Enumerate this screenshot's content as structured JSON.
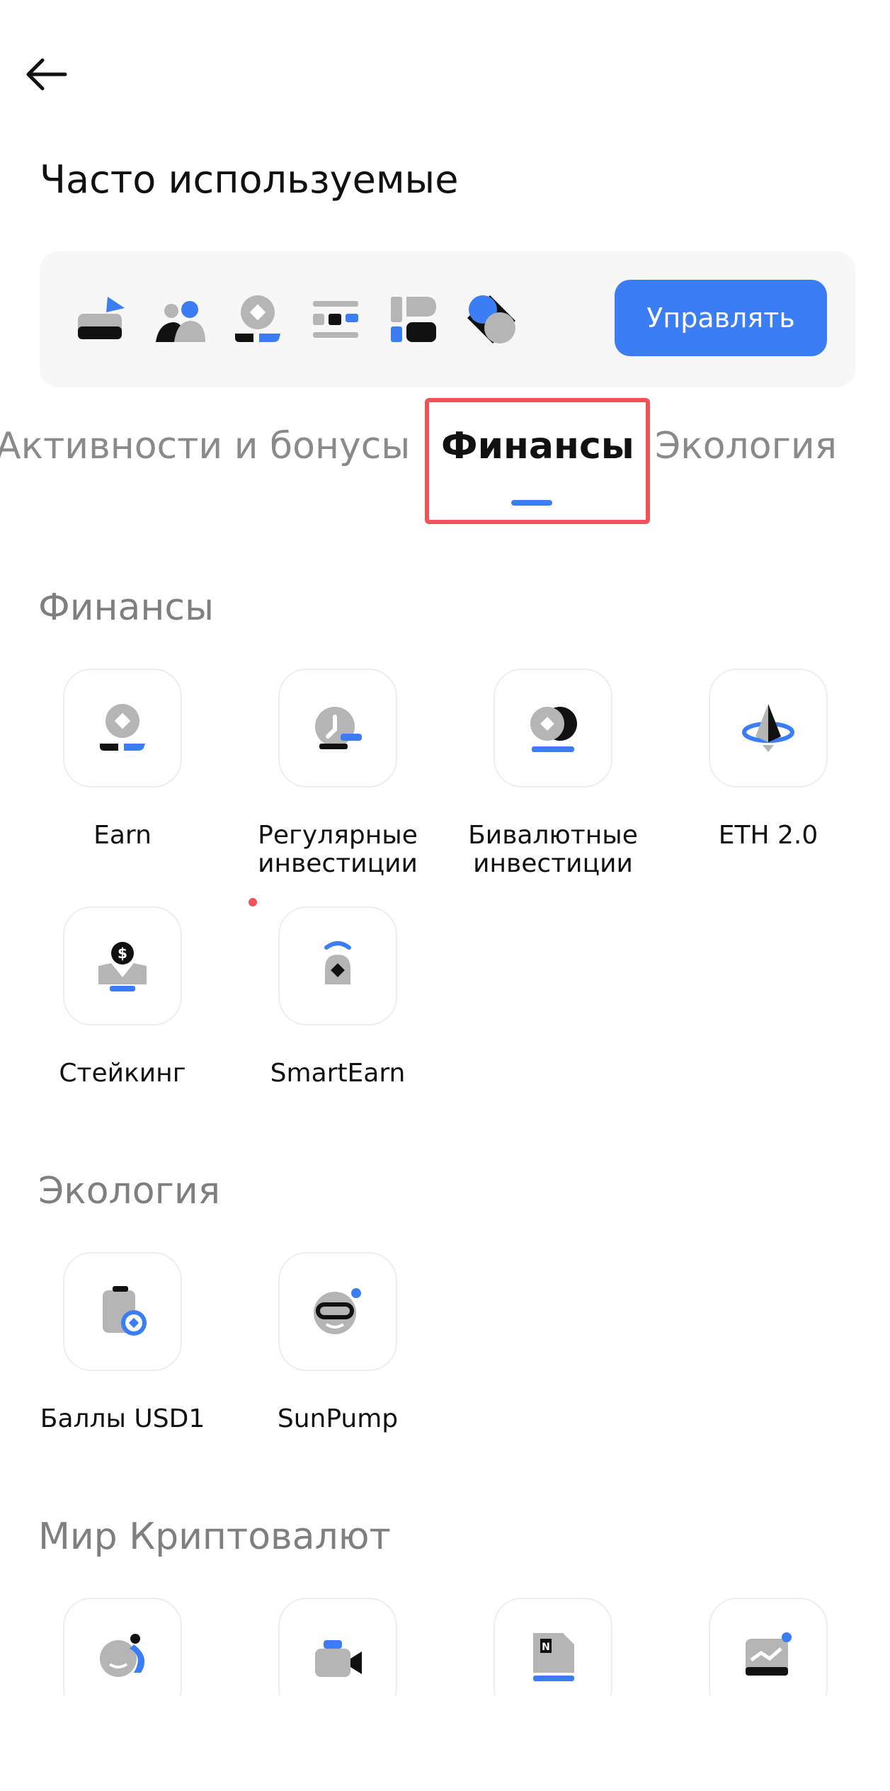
{
  "header": {
    "back_icon": "arrow-left-icon"
  },
  "page_title": "Часто используемые",
  "frequent": {
    "icons": [
      "wallet-send-icon",
      "referral-users-icon",
      "earn-coin-icon",
      "copy-trading-icon",
      "grid-bot-icon",
      "apps-icon"
    ],
    "manage_label": "Управлять"
  },
  "tabs": [
    {
      "label": "Активности и бонусы",
      "active": false
    },
    {
      "label": "Финансы",
      "active": true
    },
    {
      "label": "Экология",
      "active": false
    }
  ],
  "sections": {
    "finance": {
      "title": "Финансы",
      "items": [
        {
          "label": "Earn",
          "icon": "earn-icon"
        },
        {
          "label": "Регулярные инвестиции",
          "icon": "recurring-invest-icon"
        },
        {
          "label": "Бивалютные инвестиции",
          "icon": "dual-invest-icon"
        },
        {
          "label": "ETH 2.0",
          "icon": "eth-icon"
        },
        {
          "label": "Стейкинг",
          "icon": "staking-icon"
        },
        {
          "label": "SmartEarn",
          "icon": "smartearn-icon"
        }
      ]
    },
    "ecology": {
      "title": "Экология",
      "items": [
        {
          "label": "Баллы USD1",
          "icon": "usd1-points-icon"
        },
        {
          "label": "SunPump",
          "icon": "sunpump-icon"
        }
      ]
    },
    "crypto_world": {
      "title": "Мир Криптовалют",
      "items": [
        {
          "label": "",
          "icon": "chat-icon"
        },
        {
          "label": "",
          "icon": "live-video-icon"
        },
        {
          "label": "",
          "icon": "news-icon"
        },
        {
          "label": "",
          "icon": "market-insights-icon"
        }
      ]
    }
  },
  "colors": {
    "accent": "#3a7df5",
    "highlight": "#ef5358",
    "icon_gray": "#b5b5b5",
    "text_muted": "#8a8a8a"
  }
}
